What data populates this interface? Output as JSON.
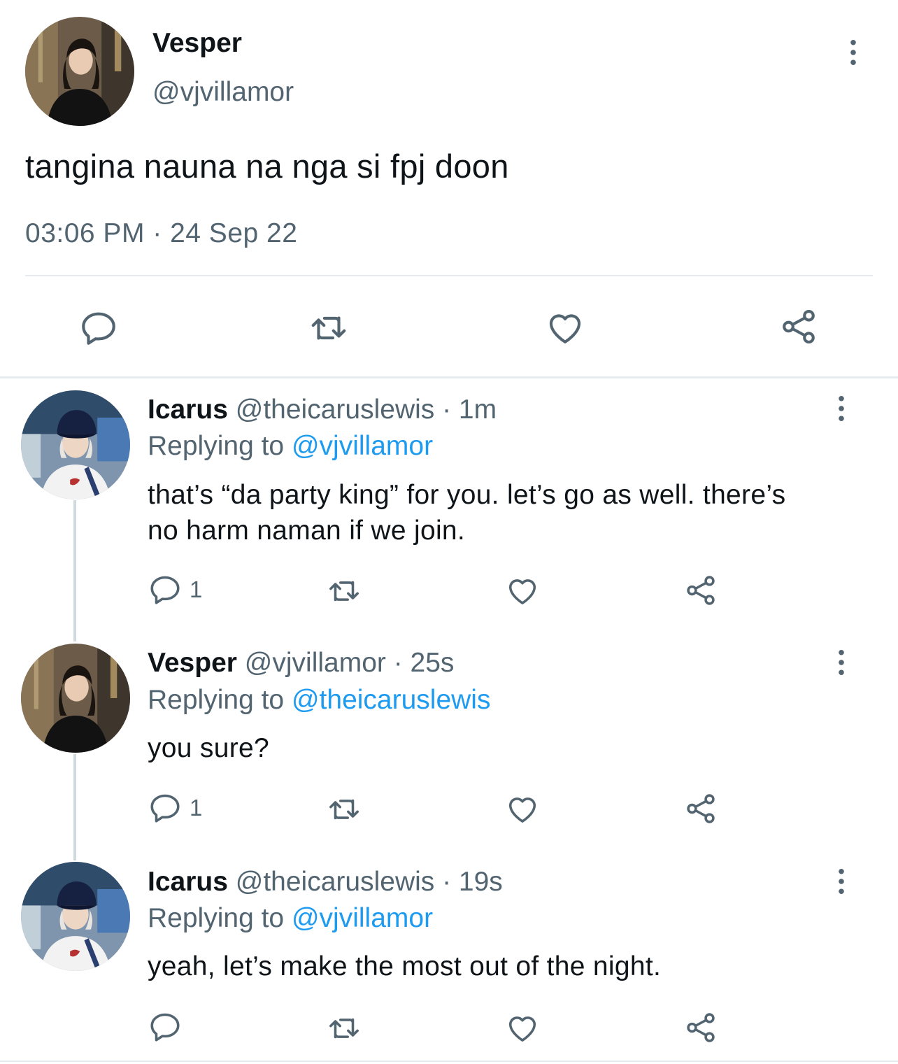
{
  "main_tweet": {
    "author_name": "Vesper",
    "author_handle": "@vjvillamor",
    "text": "tangina nauna na nga si fpj doon",
    "timestamp": "03:06 PM · 24 Sep 22",
    "actions": [
      "reply-icon",
      "retweet-icon",
      "like-icon",
      "share-icon"
    ]
  },
  "replies": [
    {
      "name": "Icarus",
      "meta": "@theicaruslewis · 1m",
      "replying_prefix": "Replying to ",
      "replying_to": "@vjvillamor",
      "text": "that’s “da party king” for you. let’s go as well. there’s no harm naman if we join.",
      "reply_count": "1"
    },
    {
      "name": "Vesper",
      "meta": "@vjvillamor · 25s",
      "replying_prefix": "Replying to ",
      "replying_to": "@theicaruslewis",
      "text": "you sure?",
      "reply_count": "1"
    },
    {
      "name": "Icarus",
      "meta": "@theicaruslewis · 19s",
      "replying_prefix": "Replying to ",
      "replying_to": "@vjvillamor",
      "text": "yeah, let’s make the most out of the night.",
      "reply_count": ""
    }
  ],
  "colors": {
    "text": "#0f1419",
    "secondary": "#536471",
    "link": "#1d9bf0",
    "divider": "#e6ebef"
  }
}
